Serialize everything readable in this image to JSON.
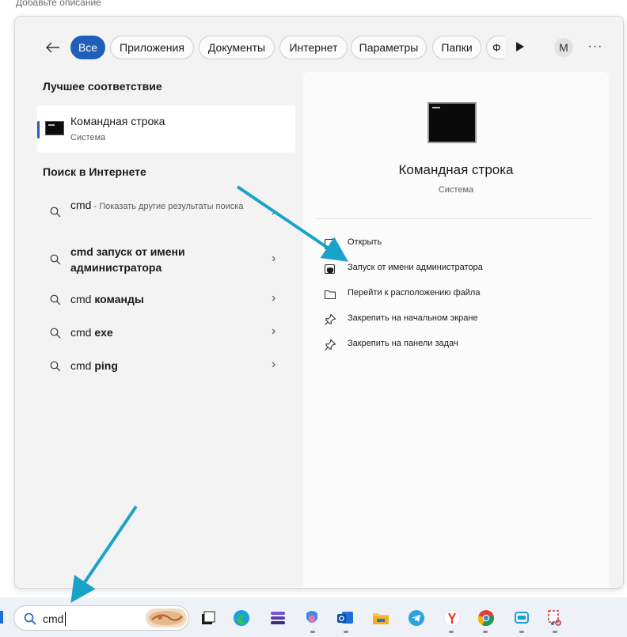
{
  "caption": "Добавьте описание",
  "header": {
    "chips": [
      "Все",
      "Приложения",
      "Документы",
      "Интернет",
      "Параметры",
      "Папки",
      "Ф"
    ],
    "avatar_initial": "M",
    "more": "···"
  },
  "best_match": {
    "title": "Лучшее соответствие",
    "name": "Командная строка",
    "sub": "Система"
  },
  "web": {
    "title": "Поиск в Интернете",
    "rows": [
      {
        "pre": "cmd",
        "hint": " - Показать другие результаты поиска"
      },
      {
        "pre": "cmd запуск от имени администратора",
        "bold": true
      },
      {
        "pre": "cmd ",
        "boldpart": "команды"
      },
      {
        "pre": "cmd ",
        "boldpart": "exe"
      },
      {
        "pre": "cmd ",
        "boldpart": "ping"
      }
    ]
  },
  "detail": {
    "name": "Командная строка",
    "sub": "Система",
    "actions": [
      {
        "label": "Открыть",
        "icon": "open-icon"
      },
      {
        "label": "Запуск от имени администратора",
        "icon": "admin-shield-icon"
      },
      {
        "label": "Перейти к расположению файла",
        "icon": "folder-icon"
      },
      {
        "label": "Закрепить на начальном экране",
        "icon": "pin-icon"
      },
      {
        "label": "Закрепить на панели задач",
        "icon": "pin-icon"
      }
    ]
  },
  "taskbar": {
    "search_value": "cmd",
    "apps": [
      "task-view-icon",
      "edge-icon",
      "stack-icon",
      "copilot-icon",
      "outlook-icon",
      "file-explorer-icon",
      "telegram-icon",
      "yandex-icon",
      "chrome-icon",
      "app-icon",
      "snipping-icon"
    ]
  },
  "colors": {
    "accent": "#1f5fb8",
    "arrow": "#1aa3c9"
  }
}
